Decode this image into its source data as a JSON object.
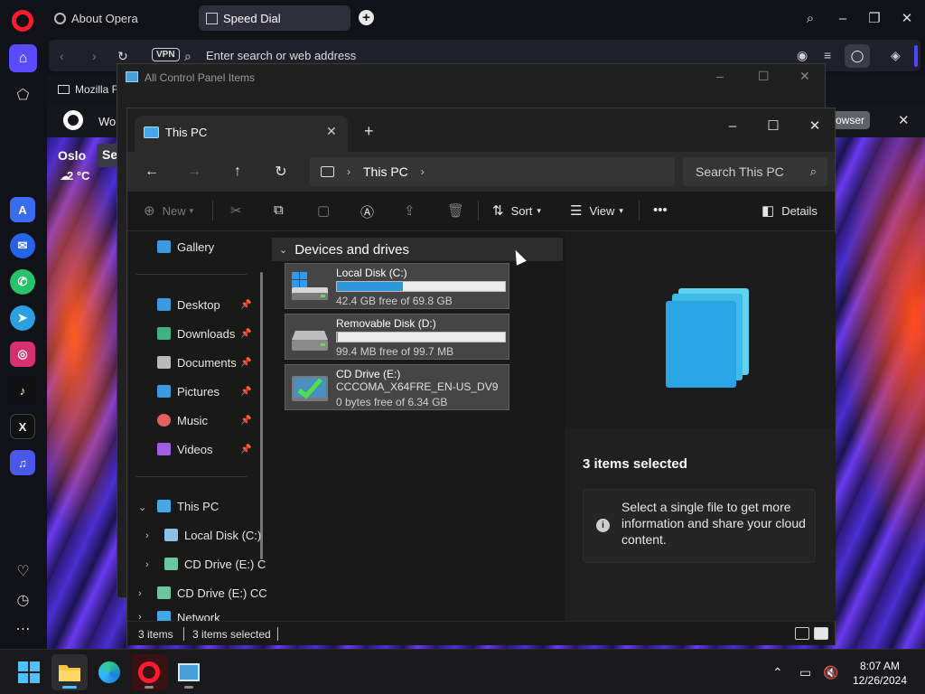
{
  "opera": {
    "tabs": [
      {
        "label": "About Opera"
      },
      {
        "label": "Speed Dial"
      }
    ],
    "address_placeholder": "Enter search or web address",
    "vpn_label": "VPN",
    "bookmark_label": "Mozilla F",
    "banner_text": "Wou",
    "banner_button": "rowser",
    "weather": {
      "city": "Oslo",
      "temp": "2 °C",
      "partial": "Se"
    }
  },
  "control_panel": {
    "title": "All Control Panel Items"
  },
  "explorer": {
    "tab_title": "This PC",
    "breadcrumb": [
      "This PC"
    ],
    "search_placeholder": "Search This PC",
    "commands": {
      "new": "New",
      "sort": "Sort",
      "view": "View",
      "details": "Details"
    },
    "nav_pane": {
      "gallery": "Gallery",
      "quick_access": [
        {
          "label": "Desktop",
          "icon": "desktop-icon",
          "color": "#3b9be0"
        },
        {
          "label": "Downloads",
          "icon": "download-icon",
          "color": "#3fb27f"
        },
        {
          "label": "Documents",
          "icon": "document-icon",
          "color": "#b9b9b9"
        },
        {
          "label": "Pictures",
          "icon": "pictures-icon",
          "color": "#3b9be0"
        },
        {
          "label": "Music",
          "icon": "music-icon",
          "color": "#e26060"
        },
        {
          "label": "Videos",
          "icon": "videos-icon",
          "color": "#a25ee0"
        }
      ],
      "this_pc": "This PC",
      "this_pc_children": [
        {
          "label": "Local Disk (C:)"
        },
        {
          "label": "CD Drive (E:) C"
        }
      ],
      "cd_drive": "CD Drive (E:) CC",
      "network": "Network"
    },
    "group_header": "Devices and drives",
    "drives": [
      {
        "name": "Local Disk (C:)",
        "free": "42.4 GB free of 69.8 GB",
        "used_fraction": 0.39,
        "icon": "hard-disk-icon"
      },
      {
        "name": "Removable Disk (D:)",
        "free": "99.4 MB free of 99.7 MB",
        "used_fraction": 0.003,
        "icon": "removable-disk-icon"
      },
      {
        "name": "CD Drive (E:)",
        "label": "CCCOMA_X64FRE_EN-US_DV9",
        "free": "0 bytes free of 6.34 GB",
        "icon": "cd-drive-icon"
      }
    ],
    "details": {
      "count": "3 items selected",
      "info": "Select a single file to get more information and share your cloud content."
    },
    "status": {
      "items": "3 items",
      "selected": "3 items selected"
    }
  },
  "taskbar": {
    "clock_time": "8:07 AM",
    "clock_date": "12/26/2024"
  },
  "colors": {
    "opera_red": "#ff1b2d",
    "opera_accent": "#5b4bff",
    "drive_fill": "#2c96d8"
  }
}
